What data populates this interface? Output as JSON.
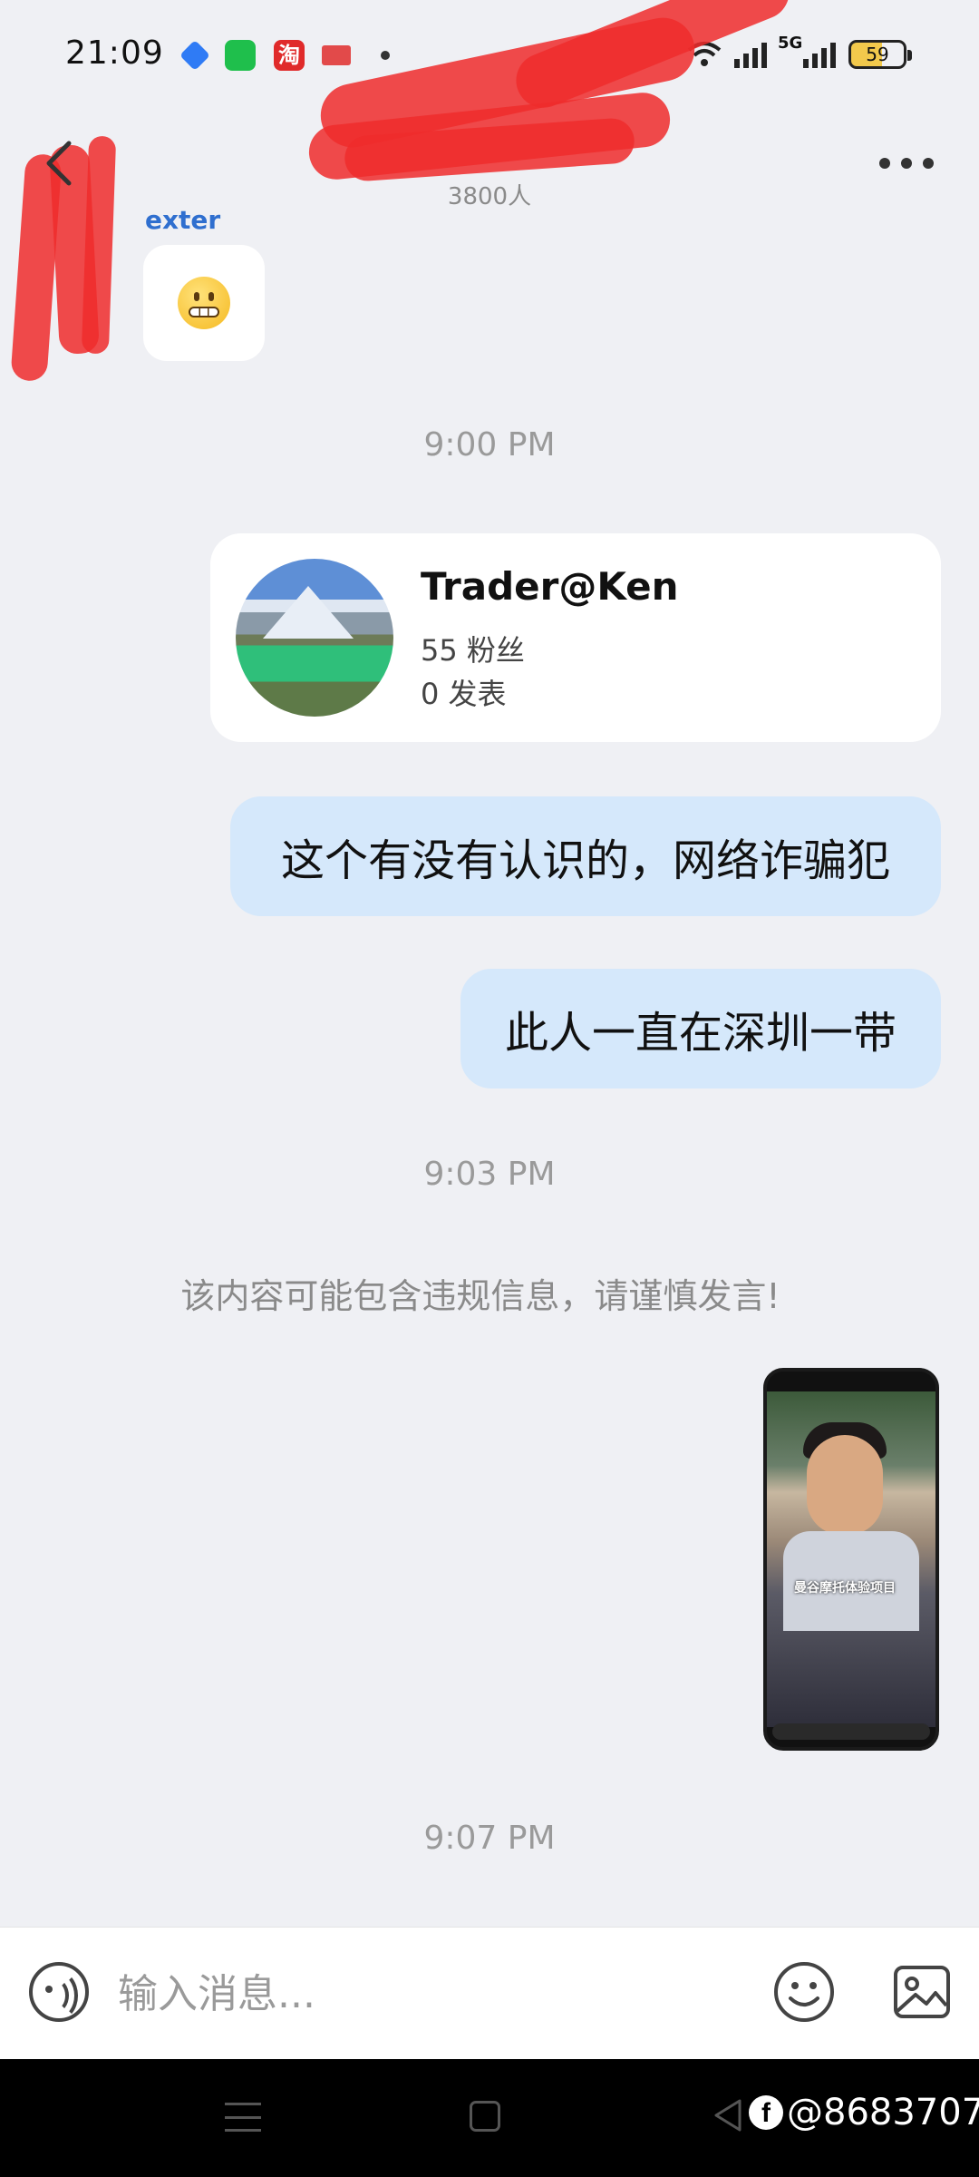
{
  "status_bar": {
    "time": "21:09",
    "notification_app_label": "淘",
    "network_label": "5G",
    "battery_level": "59"
  },
  "header": {
    "title": "",
    "member_count": "3800人"
  },
  "messages": {
    "incoming_sender": "exter",
    "time_1": "9:00 PM",
    "contact_card": {
      "name": "Trader@Ken",
      "followers": "55 粉丝",
      "posts": "0 发表"
    },
    "text_1": "这个有没有认识的，网络诈骗犯",
    "text_2": "此人一直在深圳一带",
    "time_2": "9:03 PM",
    "system_notice": "该内容可能包含违规信息，请谨慎发言!",
    "screenshot_caption": "曼谷摩托体验项目",
    "time_3": "9:07 PM"
  },
  "input_bar": {
    "placeholder": "输入消息..."
  },
  "watermark": {
    "handle": "@8683707"
  },
  "colors": {
    "background": "#eff0f4",
    "outgoing_bubble": "#d5e8fb",
    "incoming_bubble": "#ffffff",
    "timestamp": "#9a9a9a",
    "redaction": "#ef2b2b"
  }
}
